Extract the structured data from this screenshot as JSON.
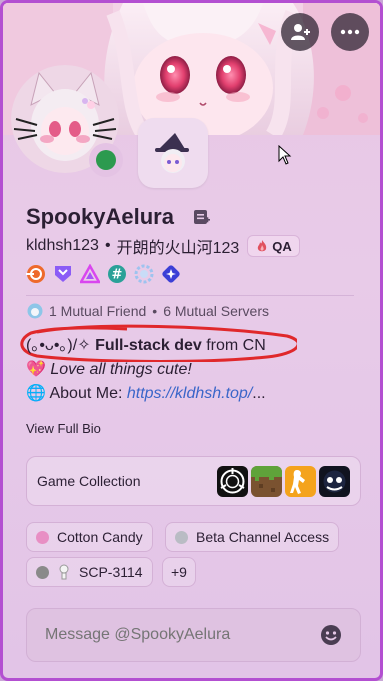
{
  "profile": {
    "display_name": "SpookyAelura",
    "username": "kldhsh123",
    "separator": "•",
    "pronoun_text": "开朗的火山河123",
    "tag_label": "QA"
  },
  "banner": {
    "add_friend_icon": "add-friend-icon",
    "more_icon": "more-icon"
  },
  "badges": [
    "hypesquad-icon",
    "nitro-icon",
    "early-dev-icon",
    "hashtag-icon",
    "boost-icon",
    "quest-icon"
  ],
  "mutual": {
    "friends": "1 Mutual Friend",
    "separator": "•",
    "servers": "6 Mutual Servers"
  },
  "bio": {
    "line1_prefix": "(｡•ᴗ•｡)/✧ ",
    "line1_bold": "Full-stack dev",
    "line1_suffix": " from CN",
    "line2_emoji": "💖",
    "line2_text": "Love all things cute!",
    "line3_emoji": "🌐",
    "line3_label": "About Me: ",
    "line3_link": "https://kldhsh.top/",
    "line3_ellipsis": "..."
  },
  "view_full_bio": "View Full Bio",
  "games": {
    "label": "Game Collection",
    "icons": [
      "scp-icon",
      "minecraft-icon",
      "counter-strike-icon",
      "game-icon"
    ]
  },
  "roles": [
    {
      "label": "Cotton Candy",
      "color": "#e88fc4"
    },
    {
      "label": "Beta Channel Access",
      "color": "#b9bcc4"
    },
    {
      "label": "SCP-3114",
      "color": "#8a8a8a"
    }
  ],
  "roles_more": "+9",
  "message": {
    "placeholder": "Message @SpookyAelura"
  },
  "colors": {
    "accent_border": "#b34fd1",
    "status_online": "#2c9a4f",
    "link": "#3a66c9",
    "annotation": "#e0282b"
  }
}
